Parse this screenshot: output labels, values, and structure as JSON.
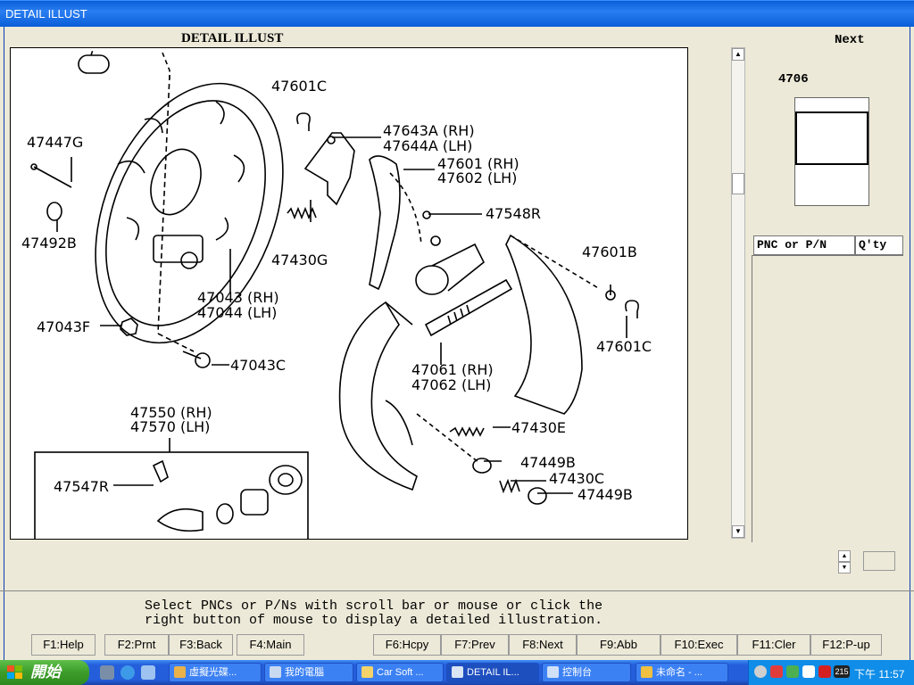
{
  "window": {
    "title": "DETAIL ILLUST"
  },
  "illustration": {
    "heading": "DETAIL ILLUST",
    "labels": {
      "l47601C_top": "47601C",
      "l47447G": "47447G",
      "l47643A": "47643A (RH)",
      "l47644A": "47644A (LH)",
      "l47601": "47601 (RH)",
      "l47602": "47602 (LH)",
      "l47548R": "47548R",
      "l47492B": "47492B",
      "l47430G": "47430G",
      "l47601B": "47601B",
      "l47043": "47043 (RH)",
      "l47044": "47044 (LH)",
      "l47043F": "47043F",
      "l47601C_bot": "47601C",
      "l47043C": "47043C",
      "l47061": "47061 (RH)",
      "l47062": "47062 (LH)",
      "l47550": "47550 (RH)",
      "l47570": "47570 (LH)",
      "l47430E": "47430E",
      "l47547R": "47547R",
      "l47449B_a": "47449B",
      "l47430C": "47430C",
      "l47449B_b": "47449B"
    }
  },
  "side_panel": {
    "next_label": "Next",
    "group_code": "4706",
    "pnc_col": "PNC or P/N",
    "qty_col": "Q'ty"
  },
  "message": {
    "line1": "Select PNCs or P/Ns with scroll bar or mouse or click the",
    "line2": "right button of mouse to display a detailed illustration."
  },
  "fkeys": {
    "f1": "F1:Help",
    "f2": "F2:Prnt",
    "f3": "F3:Back",
    "f4": "F4:Main",
    "f6": "F6:Hcpy",
    "f7": "F7:Prev",
    "f8": "F8:Next",
    "f9": "F9:Abb",
    "f10": "F10:Exec",
    "f11": "F11:Cler",
    "f12": "F12:P-up"
  },
  "taskbar": {
    "start": "開始",
    "tasks": {
      "t1": "虛擬光碟...",
      "t2": "我的電腦",
      "t3": "Car Soft ...",
      "t4": "DETAIL IL...",
      "t5": "控制台",
      "t6": "未命名 - ..."
    },
    "tray_num": "215",
    "clock": "下午 11:57"
  },
  "colors": {
    "titlebar": "#0a5ed7",
    "taskbar": "#245edb",
    "start": "#3c9c2a",
    "tray": "#0f8de8"
  }
}
